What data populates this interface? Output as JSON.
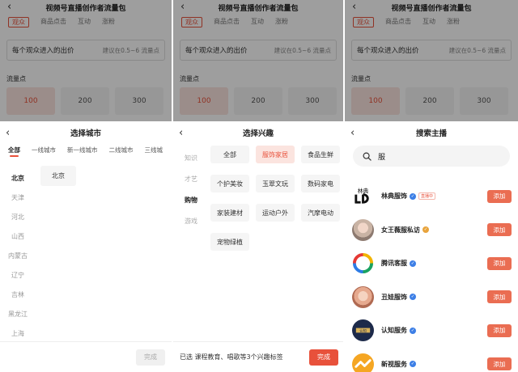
{
  "background_page": {
    "title": "视频号直播创作者流量包",
    "tabs": [
      "观众",
      "商品点击",
      "互动",
      "涨粉"
    ],
    "bid_label": "每个观众进入的出价",
    "bid_hint": "建议在0.5~6 流量点",
    "traffic_label": "流量点",
    "traffic_options": [
      "100",
      "200",
      "300"
    ]
  },
  "city_sheet": {
    "title": "选择城市",
    "tabs": [
      "全部",
      "一线城市",
      "新一线城市",
      "二线城市",
      "三线城"
    ],
    "provinces": [
      "北京",
      "天津",
      "河北",
      "山西",
      "内蒙古",
      "辽宁",
      "吉林",
      "黑龙江",
      "上海"
    ],
    "selected_city": "北京",
    "done_label": "完成"
  },
  "interest_sheet": {
    "title": "选择兴趣",
    "categories": [
      "知识",
      "才艺",
      "购物",
      "游戏"
    ],
    "chips": [
      "全部",
      "服饰家居",
      "食品生鲜",
      "个护美妆",
      "玉翠文玩",
      "数码家电",
      "家装建材",
      "运动户外",
      "汽摩电动",
      "宠物绿植"
    ],
    "selected_text": "已选 课程教育、唱歌等3个兴趣标签",
    "done_label": "完成"
  },
  "host_sheet": {
    "title": "搜索主播",
    "search_value": "服",
    "add_label": "添加",
    "live_tag": "直播中",
    "hosts": [
      {
        "name": "林典服饰",
        "avatar_text": "林典"
      },
      {
        "name": "女王薇服私访",
        "avatar_text": ""
      },
      {
        "name": "腾讯客服",
        "avatar_text": ""
      },
      {
        "name": "丑娃服饰",
        "avatar_text": ""
      },
      {
        "name": "认知服务",
        "avatar_text": "认知"
      },
      {
        "name": "新视服务",
        "avatar_text": ""
      }
    ]
  },
  "colors": {
    "accent": "#e8513b",
    "add_button": "#ea6d52",
    "badge_blue": "#3d7fe6",
    "badge_gold": "#e8a33b"
  }
}
